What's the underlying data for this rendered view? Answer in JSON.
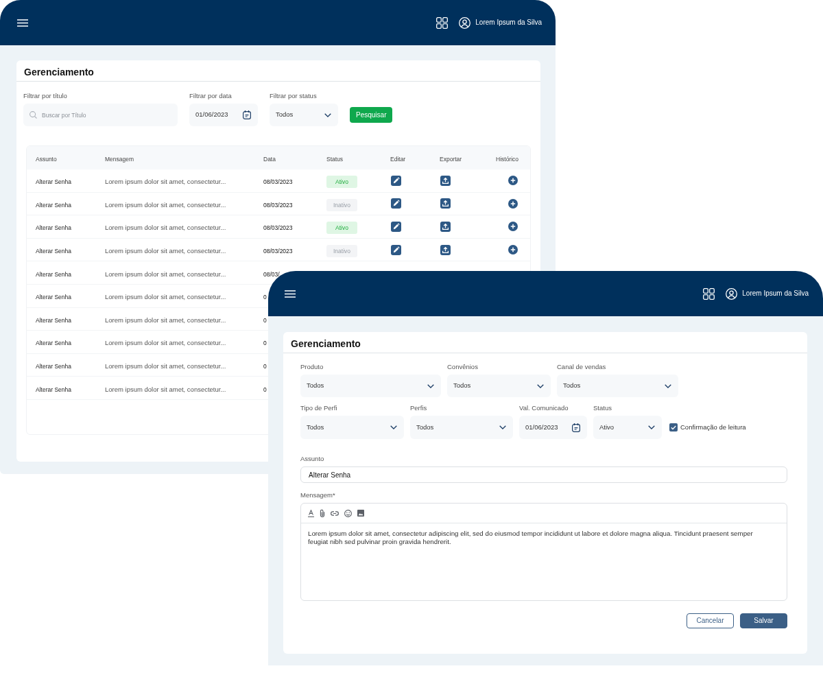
{
  "list_window": {
    "header": {
      "user_name": "Lorem Ipsum da Silva"
    },
    "title": "Gerenciamento",
    "filters": [
      {
        "kind": "search",
        "label": "Filtrar por título",
        "placeholder": "Buscar por Título"
      },
      {
        "kind": "date",
        "label": "Filtrar por data",
        "value": "01/06/2023"
      },
      {
        "kind": "select",
        "label": "Filtrar por status",
        "value": "Todos"
      }
    ],
    "search_button": "Pesquisar",
    "table": {
      "columns": [
        "Assunto",
        "Mensagem",
        "Data",
        "Status",
        "Editar",
        "Exportar",
        "Histórico"
      ],
      "rows": [
        {
          "subject": "Alterar Senha",
          "message": "Lorem ipsum dolor sit amet, consectetur...",
          "date": "08/03/2023",
          "status": {
            "label": "Ativo",
            "active": true
          },
          "actions": true
        },
        {
          "subject": "Alterar Senha",
          "message": "Lorem ipsum dolor sit amet, consectetur...",
          "date": "08/03/2023",
          "status": {
            "label": "Inativo",
            "active": false
          },
          "actions": true
        },
        {
          "subject": "Alterar Senha",
          "message": "Lorem ipsum dolor sit amet, consectetur...",
          "date": "08/03/2023",
          "status": {
            "label": "Ativo",
            "active": true
          },
          "actions": true
        },
        {
          "subject": "Alterar Senha",
          "message": "Lorem ipsum dolor sit amet, consectetur...",
          "date": "08/03/2023",
          "status": {
            "label": "Inativo",
            "active": false
          },
          "actions": true
        },
        {
          "subject": "Alterar Senha",
          "message": "Lorem ipsum dolor sit amet, consectetur...",
          "date": "08/03/",
          "actions": false
        },
        {
          "subject": "Alterar Senha",
          "message": "Lorem ipsum dolor sit amet, consectetur...",
          "date": "0",
          "actions": false
        },
        {
          "subject": "Alterar Senha",
          "message": "Lorem ipsum dolor sit amet, consectetur...",
          "date": "0",
          "actions": false
        },
        {
          "subject": "Alterar Senha",
          "message": "Lorem ipsum dolor sit amet, consectetur...",
          "date": "0",
          "actions": false
        },
        {
          "subject": "Alterar Senha",
          "message": "Lorem ipsum dolor sit amet, consectetur...",
          "date": "0",
          "actions": false
        },
        {
          "subject": "Alterar Senha",
          "message": "Lorem ipsum dolor sit amet, consectetur...",
          "date": "0",
          "actions": false
        }
      ]
    }
  },
  "edit_window": {
    "header": {
      "user_name": "Lorem Ipsum da Silva"
    },
    "title": "Gerenciamento",
    "field_rows": [
      [
        {
          "kind": "select",
          "label": "Produto",
          "value": "Todos"
        },
        {
          "kind": "select",
          "label": "Convênios",
          "value": "Todos"
        },
        {
          "kind": "select",
          "label": "Canal de vendas",
          "value": "Todos"
        }
      ],
      [
        {
          "kind": "select",
          "label": "Tipo de Perfi",
          "value": "Todos"
        },
        {
          "kind": "select",
          "label": "Perfis",
          "value": "Todos"
        },
        {
          "kind": "date",
          "label": "Val. Comunicado",
          "value": "01/06/2023"
        },
        {
          "kind": "select",
          "label": "Status",
          "value": "Ativo"
        }
      ]
    ],
    "confirm_read": {
      "label": "Confirmação de leitura",
      "checked": true
    },
    "subject": {
      "label": "Assunto",
      "value": "Alterar Senha"
    },
    "message": {
      "label": "Mensagem*",
      "value": "Lorem ipsum dolor sit amet, consectetur adipiscing elit, sed do eiusmod tempor incididunt ut labore et dolore magna aliqua. Tincidunt praesent semper feugiat nibh sed pulvinar proin gravida hendrerit."
    },
    "buttons": [
      {
        "label": "Cancelar",
        "kind": "outline"
      },
      {
        "label": "Salvar",
        "kind": "primary"
      }
    ]
  }
}
